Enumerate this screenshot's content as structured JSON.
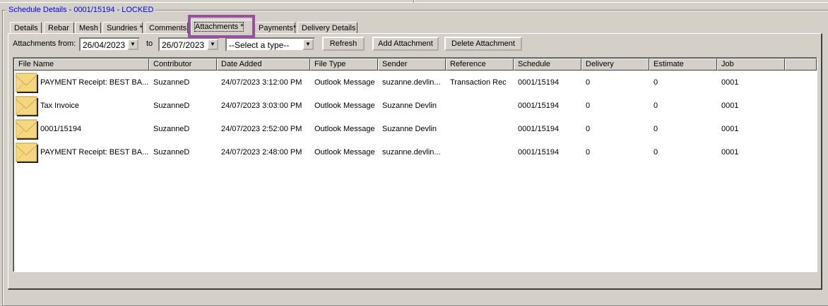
{
  "group_title": "Schedule Details - 0001/15194 - LOCKED",
  "tabs": [
    "Details",
    "Rebar",
    "Mesh",
    "Sundries *",
    "Comments",
    "Attachments *",
    "Payments*",
    "Delivery Details"
  ],
  "active_tab": "Attachments *",
  "toolbar": {
    "from_label": "Attachments from:",
    "from_date": "26/04/2023",
    "to_label": "to",
    "to_date": "26/07/2023",
    "type_select": "--Select a type--",
    "refresh": "Refresh",
    "add": "Add Attachment",
    "delete": "Delete Attachment"
  },
  "columns": [
    "File Name",
    "Contributor",
    "Date Added",
    "File Type",
    "Sender",
    "Reference",
    "Schedule",
    "Delivery",
    "Estimate",
    "Job",
    ""
  ],
  "rows": [
    [
      "PAYMENT Receipt: BEST BA...",
      "SuzanneD",
      "24/07/2023 3:12:00 PM",
      "Outlook Message",
      "suzanne.devlin...",
      "Transaction Rec",
      "0001/15194",
      "0",
      "0",
      "0001"
    ],
    [
      "Tax Invoice",
      "SuzanneD",
      "24/07/2023 3:03:00 PM",
      "Outlook Message",
      "Suzanne Devlin",
      "",
      "0001/15194",
      "0",
      "0",
      "0001"
    ],
    [
      "0001/15194",
      "SuzanneD",
      "24/07/2023 2:52:00 PM",
      "Outlook Message",
      "Suzanne Devlin",
      "",
      "0001/15194",
      "0",
      "0",
      "0001"
    ],
    [
      "PAYMENT Receipt: BEST BA...",
      "SuzanneD",
      "24/07/2023 2:48:00 PM",
      "Outlook Message",
      "suzanne.devlin...",
      "",
      "0001/15194",
      "0",
      "0",
      "0001"
    ]
  ],
  "colors": {
    "caption": "#0000ff",
    "highlight": "#9b4f9f",
    "envelope": "#f5d780"
  }
}
